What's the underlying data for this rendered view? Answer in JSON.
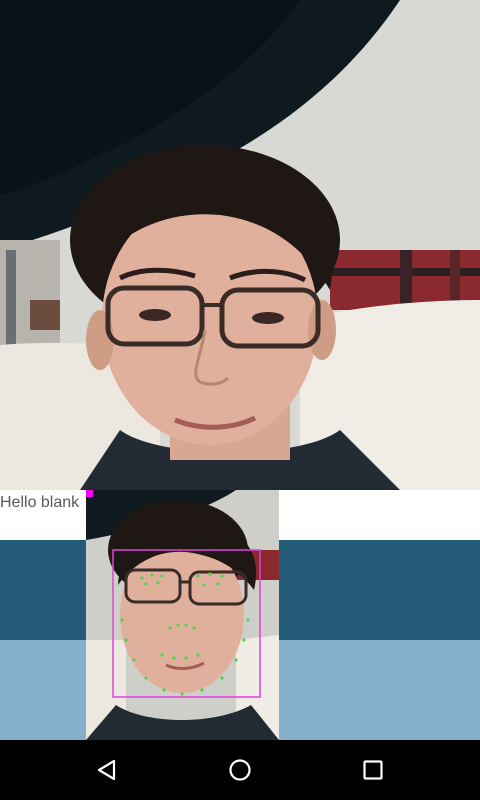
{
  "overlay": {
    "hello_text": "Hello blank"
  },
  "colors": {
    "band_dark": "#235b79",
    "band_light": "#85afcb",
    "face_box": "#e040e0",
    "landmark": "#4ed44e",
    "corner_marker": "#ff00ff",
    "nav_bar": "#000000",
    "nav_icon": "#ffffff"
  },
  "navigation": {
    "back_icon": "back-triangle-icon",
    "home_icon": "home-circle-icon",
    "recents_icon": "recents-square-icon"
  }
}
